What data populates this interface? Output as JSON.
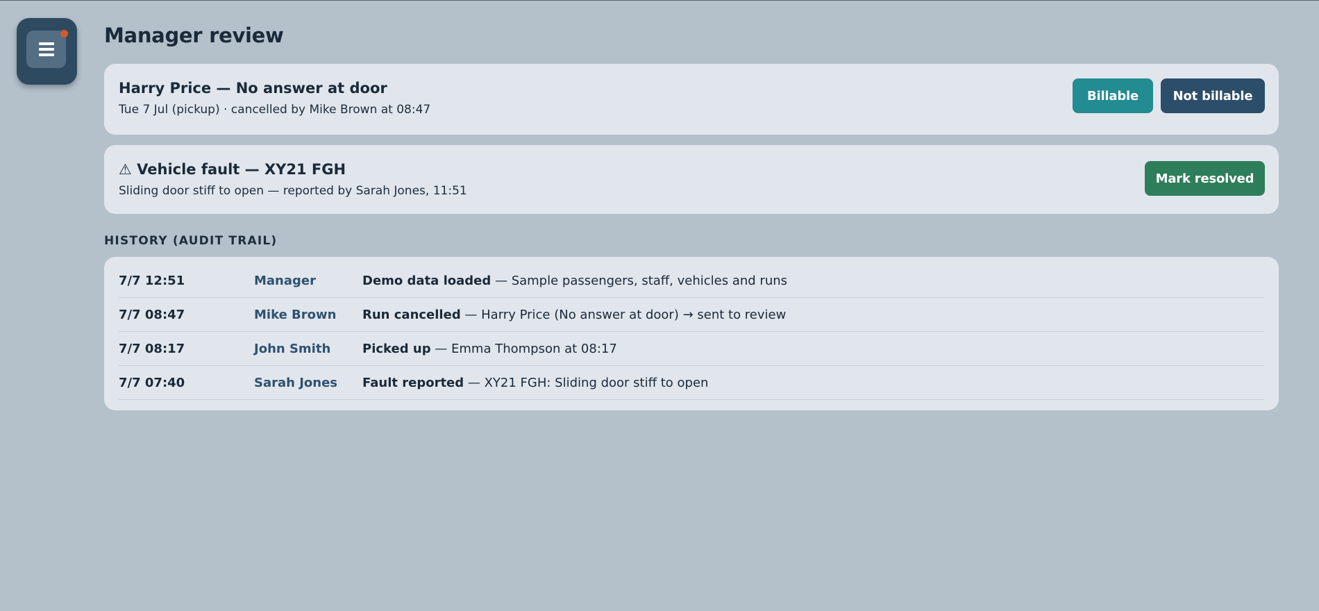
{
  "app": {
    "menu_icon": "hamburger-menu-icon",
    "notification_color": "#d35a2e"
  },
  "page": {
    "title": "Manager review"
  },
  "review_card": {
    "title": "Harry Price — No answer at door",
    "subtitle": "Tue 7 Jul (pickup) · cancelled by Mike Brown at 08:47",
    "billable_label": "Billable",
    "not_billable_label": "Not billable"
  },
  "fault_card": {
    "warning_icon": "⚠",
    "title": "Vehicle fault — XY21 FGH",
    "subtitle": "Sliding door stiff to open — reported by Sarah Jones, 11:51",
    "resolve_label": "Mark resolved"
  },
  "history": {
    "heading": "HISTORY (AUDIT TRAIL)",
    "rows": [
      {
        "time": "7/7 12:51",
        "actor": "Manager",
        "action": "Demo data loaded",
        "detail": " — Sample passengers, staff, vehicles and runs"
      },
      {
        "time": "7/7 08:47",
        "actor": "Mike Brown",
        "action": "Run cancelled",
        "detail": " — Harry Price (No answer at door) → sent to review"
      },
      {
        "time": "7/7 08:17",
        "actor": "John Smith",
        "action": "Picked up",
        "detail": " — Emma Thompson at 08:17"
      },
      {
        "time": "7/7 07:40",
        "actor": "Sarah Jones",
        "action": "Fault reported",
        "detail": " — XY21 FGH: Sliding door stiff to open"
      }
    ]
  },
  "colors": {
    "background": "#b4c1ca",
    "card": "#e1e6ed",
    "billable": "#238b92",
    "not_billable": "#2d4e6a",
    "resolve": "#2e7d5b",
    "actor_text": "#2e5270"
  }
}
